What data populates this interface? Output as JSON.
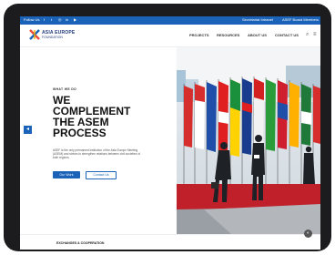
{
  "topbar": {
    "follow_label": "Follow Us",
    "social_icons": [
      "facebook-icon",
      "twitter-icon",
      "instagram-icon",
      "linkedin-icon",
      "youtube-icon"
    ],
    "right_links": [
      "Secretariat Intranet",
      "ASEF Board Members"
    ]
  },
  "brand": {
    "name": "ASIA EUROPE",
    "subname": "FOUNDATION"
  },
  "nav": {
    "items": [
      "PROJECTS",
      "RESOURCES",
      "ABOUT US",
      "CONTACT US"
    ],
    "icons": [
      "search-icon",
      "menu-icon"
    ]
  },
  "hero": {
    "eyebrow": "WHAT WE DO",
    "title_lines": [
      "WE",
      "COMPLEMENT",
      "THE ASEM",
      "PROCESS"
    ],
    "description": "ASEF is the only permanent institution of the Asia Europe Meeting (ASEM) and strives to strengthen relations between civil societies of both regions.",
    "primary_button": "Our Work",
    "secondary_button": "Contact Us"
  },
  "section": {
    "label": "EXCHANGES & COOPERATION"
  },
  "colors": {
    "brand_blue": "#1a63b8",
    "carpet_red": "#c0202a"
  }
}
